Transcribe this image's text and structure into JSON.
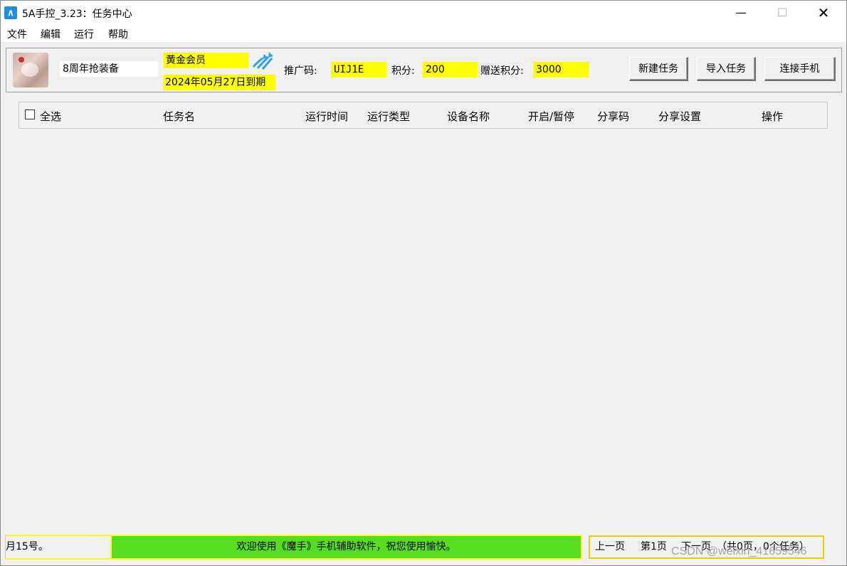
{
  "window": {
    "title": "5A手控_3.23：任务中心",
    "app_icon": "app-logo-icon",
    "controls": {
      "minimize": "—",
      "maximize": "☐",
      "close": "✕"
    }
  },
  "menu": {
    "items": [
      "文件",
      "编辑",
      "运行",
      "帮助"
    ]
  },
  "user": {
    "name": "8周年抢装备",
    "member_level": "黄金会员",
    "expiry": "2024年05月27日到期",
    "promo_label": "推广码:",
    "promo_code": "UIJ1E",
    "points_label": "积分:",
    "points": "200",
    "bonus_label": "赠送积分:",
    "bonus_points": "3000"
  },
  "actions": {
    "new_task": "新建任务",
    "import_task": "导入任务",
    "connect_phone": "连接手机"
  },
  "table": {
    "columns": {
      "select_all": "全选",
      "task_name": "任务名",
      "run_time": "运行时间",
      "run_type": "运行类型",
      "device_name": "设备名称",
      "toggle": "开启/暂停",
      "share_code": "分享码",
      "share_settings": "分享设置",
      "action": "操作"
    },
    "rows": []
  },
  "status": {
    "ticker": "月15号。",
    "welcome": "欢迎使用《魔手》手机辅助软件，祝您使用愉快。"
  },
  "pager": {
    "prev": "上一页",
    "current": "第1页",
    "next": "下一页",
    "summary": "（共0页，0个任务）"
  },
  "watermark": "CSDN @weixin_41659546",
  "colors": {
    "highlight": "#ffff00",
    "welcome_bg": "#55dd22",
    "panel_bg": "#f0f0f0"
  }
}
